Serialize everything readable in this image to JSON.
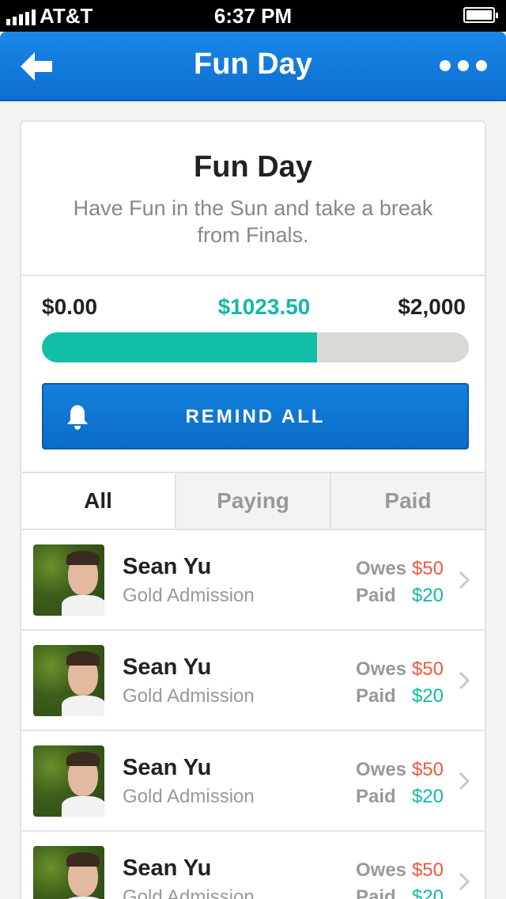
{
  "status_bar": {
    "carrier": "AT&T",
    "time": "6:37 PM"
  },
  "nav": {
    "title": "Fun Day",
    "back_icon": "arrow-left-icon",
    "more_icon": "more-dots-icon"
  },
  "event": {
    "title": "Fun Day",
    "description": "Have Fun in the Sun and take a break from Finals."
  },
  "funding": {
    "min_label": "$0.00",
    "current_label": "$1023.50",
    "max_label": "$2,000",
    "progress_fraction": 0.6448
  },
  "remind_button": {
    "label": "REMIND ALL",
    "icon": "bell-icon"
  },
  "tabs": [
    {
      "label": "All",
      "active": true
    },
    {
      "label": "Paying",
      "active": false
    },
    {
      "label": "Paid",
      "active": false
    }
  ],
  "attendees": [
    {
      "name": "Sean Yu",
      "ticket": "Gold Admission",
      "owes_label": "Owes",
      "owes": "$50",
      "paid_label": "Paid",
      "paid": "$20"
    },
    {
      "name": "Sean Yu",
      "ticket": "Gold Admission",
      "owes_label": "Owes",
      "owes": "$50",
      "paid_label": "Paid",
      "paid": "$20"
    },
    {
      "name": "Sean Yu",
      "ticket": "Gold Admission",
      "owes_label": "Owes",
      "owes": "$50",
      "paid_label": "Paid",
      "paid": "$20"
    },
    {
      "name": "Sean Yu",
      "ticket": "Gold Admission",
      "owes_label": "Owes",
      "owes": "$50",
      "paid_label": "Paid",
      "paid": "$20"
    }
  ],
  "colors": {
    "nav_blue": "#0b6fd1",
    "teal": "#12bfa6",
    "owes_red": "#f0573e"
  }
}
